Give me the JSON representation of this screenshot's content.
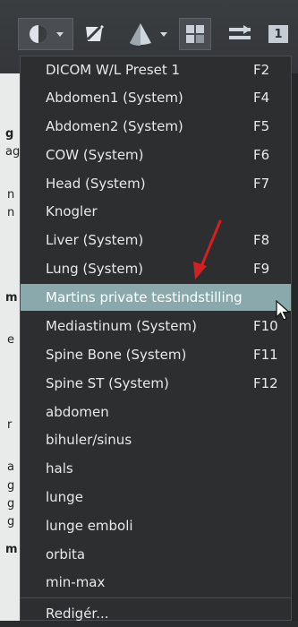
{
  "toolbar": {
    "icons": [
      "window-level-icon",
      "crop-icon",
      "cone-icon",
      "layout-grid-icon",
      "series-sync-icon",
      "screen-number-icon"
    ],
    "screen_number": "1"
  },
  "background_fragments": [
    {
      "text": "g",
      "bold": true
    },
    {
      "text": "ag",
      "bold": false
    },
    {
      "text": "n",
      "bold": false
    },
    {
      "text": "n",
      "bold": false
    },
    {
      "text": "m",
      "bold": true
    },
    {
      "text": "e",
      "bold": false
    },
    {
      "text": "r",
      "bold": false
    },
    {
      "text": "a",
      "bold": false
    },
    {
      "text": "g",
      "bold": false
    },
    {
      "text": "g",
      "bold": false
    },
    {
      "text": "g",
      "bold": false
    },
    {
      "text": "m",
      "bold": true
    }
  ],
  "menu": {
    "items": [
      {
        "label": "DICOM W/L Preset 1",
        "shortcut": "F2"
      },
      {
        "label": "Abdomen1 (System)",
        "shortcut": "F4"
      },
      {
        "label": "Abdomen2 (System)",
        "shortcut": "F5"
      },
      {
        "label": "COW (System)",
        "shortcut": "F6"
      },
      {
        "label": "Head (System)",
        "shortcut": "F7"
      },
      {
        "label": "Knogler",
        "shortcut": ""
      },
      {
        "label": "Liver (System)",
        "shortcut": "F8"
      },
      {
        "label": "Lung (System)",
        "shortcut": "F9"
      },
      {
        "label": "Martins private testindstilling",
        "shortcut": "",
        "highlighted": true
      },
      {
        "label": "Mediastinum (System)",
        "shortcut": "F10"
      },
      {
        "label": "Spine Bone (System)",
        "shortcut": "F11"
      },
      {
        "label": "Spine ST (System)",
        "shortcut": "F12"
      },
      {
        "label": "abdomen",
        "shortcut": ""
      },
      {
        "label": "bihuler/sinus",
        "shortcut": ""
      },
      {
        "label": "hals",
        "shortcut": ""
      },
      {
        "label": "lunge",
        "shortcut": ""
      },
      {
        "label": "lunge emboli",
        "shortcut": ""
      },
      {
        "label": "orbita",
        "shortcut": ""
      },
      {
        "label": "min-max",
        "shortcut": ""
      }
    ],
    "edit_label": "Redigér..."
  },
  "colors": {
    "highlight": "#8aa9ad",
    "arrow": "#d42020",
    "menu_bg": "#2c2e30"
  }
}
